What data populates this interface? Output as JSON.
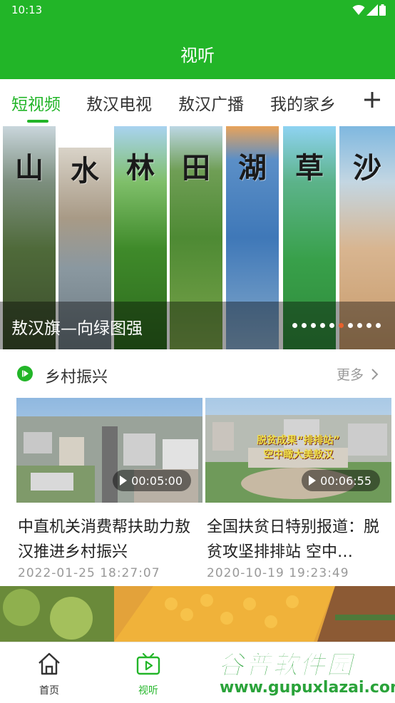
{
  "status_bar": {
    "time": "10:13",
    "icons": [
      "wifi-icon",
      "cell-signal-icon",
      "battery-icon"
    ]
  },
  "app_bar": {
    "title": "视听"
  },
  "tabs": [
    {
      "label": "短视频",
      "active": true
    },
    {
      "label": "敖汉电视",
      "active": false
    },
    {
      "label": "敖汉广播",
      "active": false
    },
    {
      "label": "我的家乡",
      "active": false
    }
  ],
  "tab_add_icon": "plus-icon",
  "banner": {
    "chars": [
      "山",
      "水",
      "林",
      "田",
      "湖",
      "草",
      "沙"
    ],
    "caption": "敖汉旗—向绿图强",
    "slide_count": 10,
    "active_slide": 6
  },
  "section": {
    "icon": "play-circle-icon",
    "title": "乡村振兴",
    "more_label": "更多",
    "more_icon": "chevron-right-icon"
  },
  "cards": [
    {
      "title": "中直机关消费帮扶助力敖汉推进乡村振兴",
      "duration": "00:05:00",
      "date": "2022-01-25 18:27:07",
      "thumb_text": []
    },
    {
      "title": "全国扶贫日特别报道：脱贫攻坚排排站 空中…",
      "duration": "00:06:55",
      "date": "2020-10-19 19:23:49",
      "thumb_text": [
        "脱贫成果“排排站”",
        "空中瞰大美敖汉"
      ]
    }
  ],
  "bottom_nav": [
    {
      "label": "首页",
      "icon": "home-icon",
      "active": false
    },
    {
      "label": "视听",
      "icon": "tv-play-icon",
      "active": true
    }
  ],
  "watermark": {
    "title": "谷普软件园",
    "url": "www.gupuxlazai.com"
  },
  "colors": {
    "brand_green": "#22b528",
    "accent_orange": "#e8612c",
    "muted_text": "#999999"
  }
}
